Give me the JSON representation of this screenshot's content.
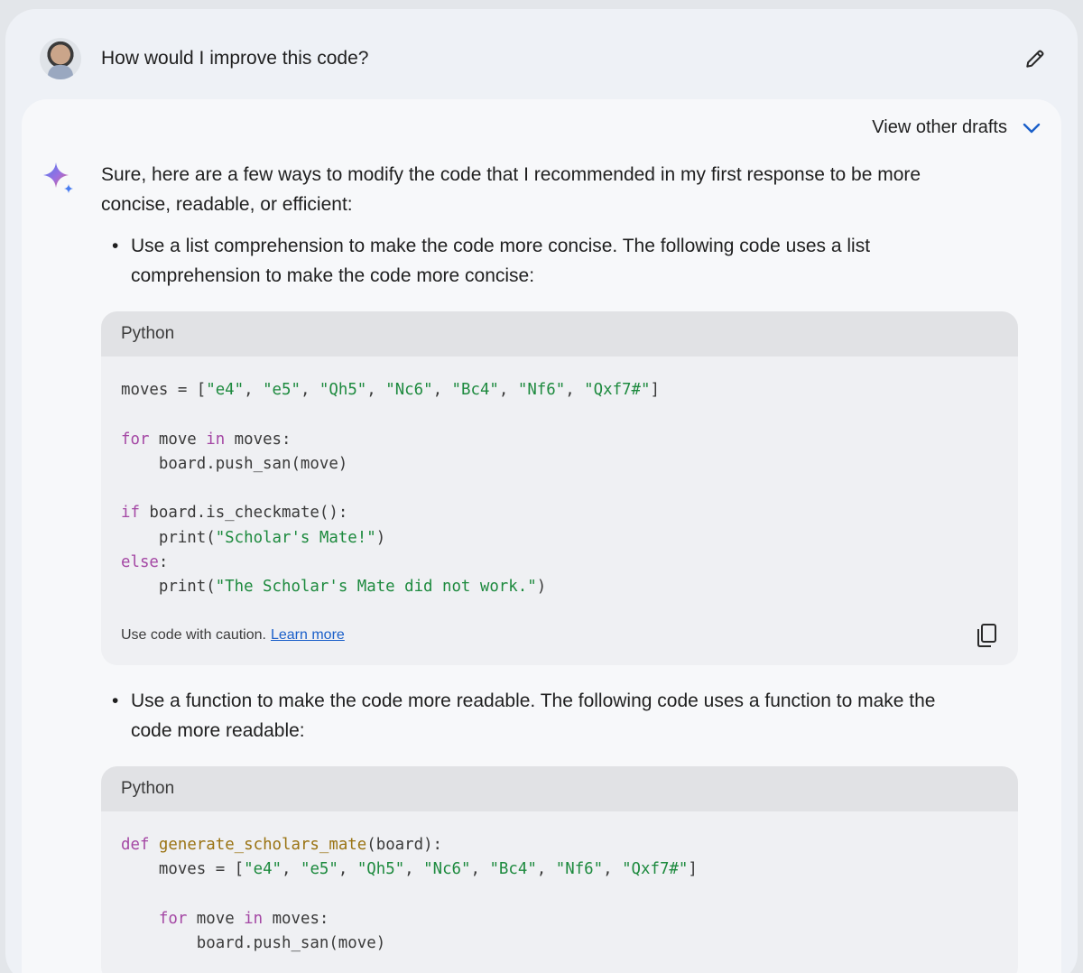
{
  "prompt": {
    "text": "How would I improve this code?",
    "avatar_icon": "user-avatar",
    "edit_icon": "pencil-icon"
  },
  "response": {
    "drafts_label": "View other drafts",
    "intro_line1": "Sure, here are a few ways to modify the code that I recommended in my first response to be more",
    "intro_line2": "concise, readable, or efficient:",
    "bullets": [
      {
        "line1": "Use a list comprehension to make the code more concise. The following code uses a list",
        "line2": "comprehension to make the code more concise:"
      },
      {
        "line1": "Use a function to make the code more readable. The following code uses a function to make the",
        "line2": "code more readable:"
      }
    ],
    "code_blocks": [
      {
        "language": "Python",
        "footer_text": "Use code with caution.",
        "footer_link": "Learn more",
        "lines": [
          [
            {
              "t": "moves = [",
              "c": ""
            },
            {
              "t": "\"e4\"",
              "c": "str"
            },
            {
              "t": ", ",
              "c": ""
            },
            {
              "t": "\"e5\"",
              "c": "str"
            },
            {
              "t": ", ",
              "c": ""
            },
            {
              "t": "\"Qh5\"",
              "c": "str"
            },
            {
              "t": ", ",
              "c": ""
            },
            {
              "t": "\"Nc6\"",
              "c": "str"
            },
            {
              "t": ", ",
              "c": ""
            },
            {
              "t": "\"Bc4\"",
              "c": "str"
            },
            {
              "t": ", ",
              "c": ""
            },
            {
              "t": "\"Nf6\"",
              "c": "str"
            },
            {
              "t": ", ",
              "c": ""
            },
            {
              "t": "\"Qxf7#\"",
              "c": "str"
            },
            {
              "t": "]",
              "c": ""
            }
          ],
          [],
          [
            {
              "t": "for",
              "c": "kw"
            },
            {
              "t": " move ",
              "c": ""
            },
            {
              "t": "in",
              "c": "kw"
            },
            {
              "t": " moves:",
              "c": ""
            }
          ],
          [
            {
              "t": "    board.push_san(move)",
              "c": ""
            }
          ],
          [],
          [
            {
              "t": "if",
              "c": "kw"
            },
            {
              "t": " board.is_checkmate():",
              "c": ""
            }
          ],
          [
            {
              "t": "    print(",
              "c": ""
            },
            {
              "t": "\"Scholar's Mate!\"",
              "c": "str"
            },
            {
              "t": ")",
              "c": ""
            }
          ],
          [
            {
              "t": "else",
              "c": "kw"
            },
            {
              "t": ":",
              "c": ""
            }
          ],
          [
            {
              "t": "    print(",
              "c": ""
            },
            {
              "t": "\"The Scholar's Mate did not work.\"",
              "c": "str"
            },
            {
              "t": ")",
              "c": ""
            }
          ]
        ]
      },
      {
        "language": "Python",
        "lines": [
          [
            {
              "t": "def",
              "c": "kw"
            },
            {
              "t": " ",
              "c": ""
            },
            {
              "t": "generate_scholars_mate",
              "c": "fn"
            },
            {
              "t": "(board):",
              "c": ""
            }
          ],
          [
            {
              "t": "    moves = [",
              "c": ""
            },
            {
              "t": "\"e4\"",
              "c": "str"
            },
            {
              "t": ", ",
              "c": ""
            },
            {
              "t": "\"e5\"",
              "c": "str"
            },
            {
              "t": ", ",
              "c": ""
            },
            {
              "t": "\"Qh5\"",
              "c": "str"
            },
            {
              "t": ", ",
              "c": ""
            },
            {
              "t": "\"Nc6\"",
              "c": "str"
            },
            {
              "t": ", ",
              "c": ""
            },
            {
              "t": "\"Bc4\"",
              "c": "str"
            },
            {
              "t": ", ",
              "c": ""
            },
            {
              "t": "\"Nf6\"",
              "c": "str"
            },
            {
              "t": ", ",
              "c": ""
            },
            {
              "t": "\"Qxf7#\"",
              "c": "str"
            },
            {
              "t": "]",
              "c": ""
            }
          ],
          [],
          [
            {
              "t": "    ",
              "c": ""
            },
            {
              "t": "for",
              "c": "kw"
            },
            {
              "t": " move ",
              "c": ""
            },
            {
              "t": "in",
              "c": "kw"
            },
            {
              "t": " moves:",
              "c": ""
            }
          ],
          [
            {
              "t": "        board.push_san(move)",
              "c": ""
            }
          ]
        ]
      }
    ]
  },
  "colors": {
    "keyword": "#a447a4",
    "string": "#1d8a3e",
    "function": "#9a7313",
    "link": "#1a5fc9",
    "accent": "#4285f4"
  }
}
